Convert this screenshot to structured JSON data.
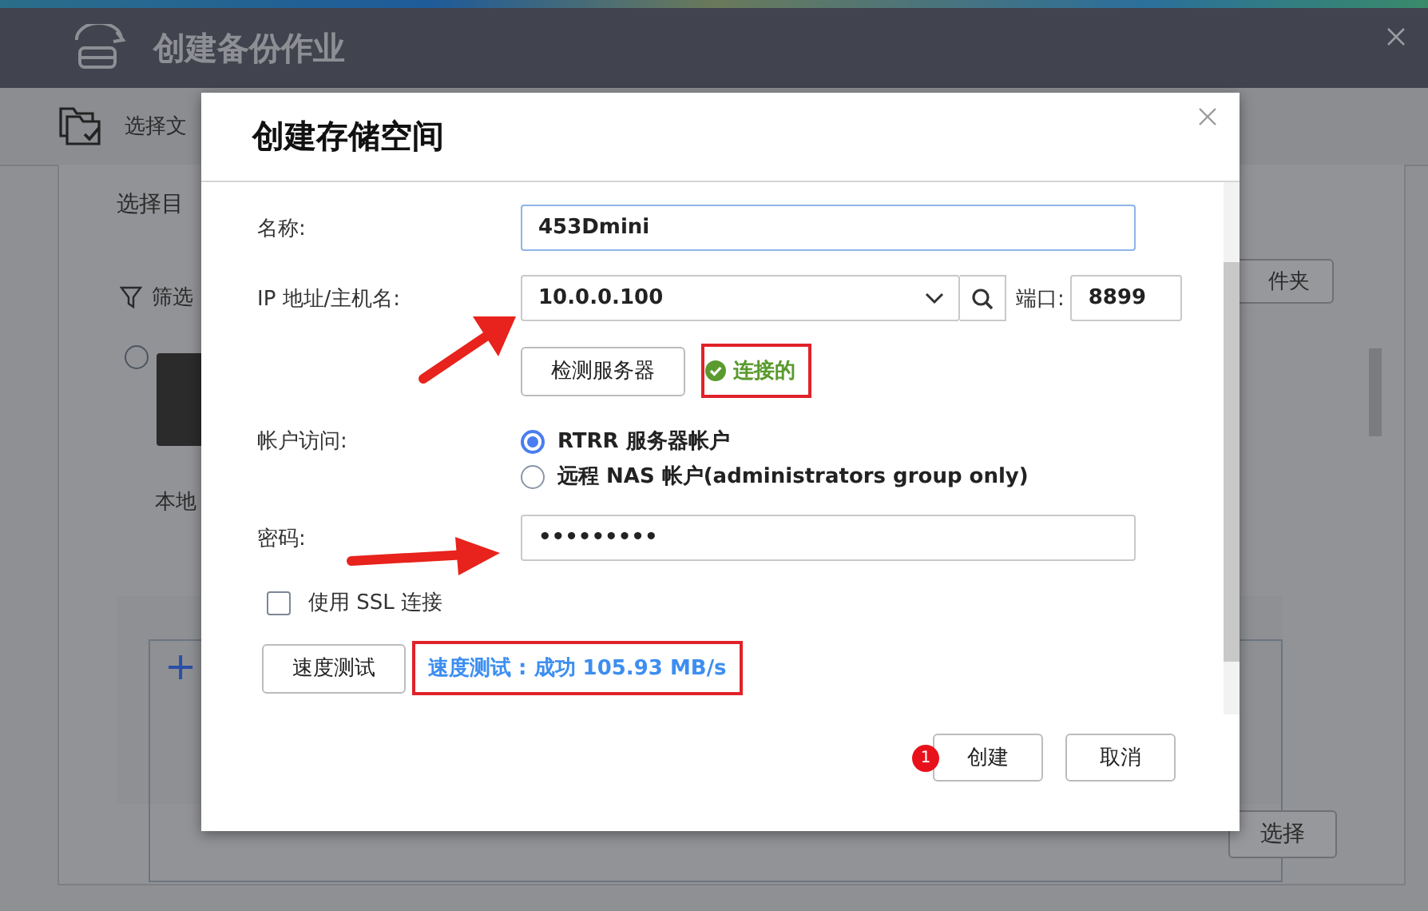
{
  "backdrop_window": {
    "title": "创建备份作业",
    "step_label": "选择文",
    "section_title": "选择目",
    "filter_label": "筛选",
    "device_selected": false,
    "device_label": "本地",
    "folder_button": "件夹",
    "add_label": "+",
    "select_button": "选择"
  },
  "dialog": {
    "title": "创建存储空间",
    "name_field": {
      "label": "名称:",
      "value": "453Dmini"
    },
    "host_field": {
      "label": "IP 地址/主机名:",
      "value": "10.0.0.100",
      "port_label": "端口:",
      "port_value": "8899"
    },
    "check_button": "检测服务器",
    "connection_status": "连接的",
    "account_access": {
      "label": "帐户访问:",
      "options": [
        {
          "label": "RTRR 服务器帐户",
          "selected": true
        },
        {
          "label": "远程 NAS 帐户(administrators group only)",
          "selected": false
        }
      ]
    },
    "password_field": {
      "label": "密码:",
      "value": "•••••••••"
    },
    "ssl": {
      "label": "使用 SSL 连接",
      "checked": false
    },
    "speed_test_button": "速度测试",
    "speed_test_result": "速度测试 : 成功 105.93 MB/s",
    "badge": "1",
    "create_button": "创建",
    "cancel_button": "取消"
  }
}
